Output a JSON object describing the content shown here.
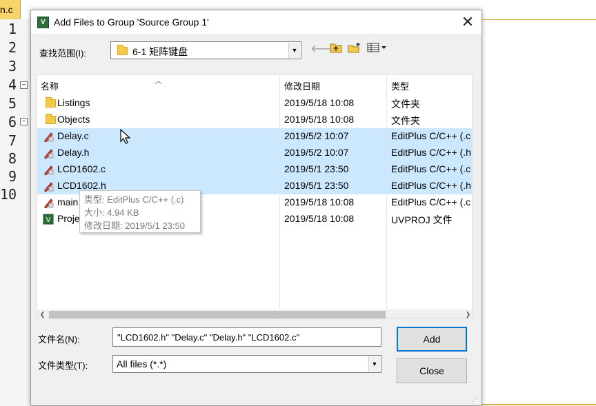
{
  "editor": {
    "tab_label": "n.c",
    "line_numbers": [
      "1",
      "2",
      "3",
      "4",
      "5",
      "6",
      "7",
      "8",
      "9",
      "10"
    ]
  },
  "dialog": {
    "title": "Add Files to Group 'Source Group 1'",
    "close_glyph": "✕",
    "look_in": {
      "label": "查找范围(I):",
      "value": "6-1 矩阵键盘"
    },
    "columns": {
      "name": "名称",
      "date": "修改日期",
      "type": "类型"
    },
    "files": [
      {
        "name": "Listings",
        "date": "2019/5/18 10:08",
        "type": "文件夹",
        "icon": "folder-icon",
        "selected": false
      },
      {
        "name": "Objects",
        "date": "2019/5/18 10:08",
        "type": "文件夹",
        "icon": "folder-icon",
        "selected": false
      },
      {
        "name": "Delay.c",
        "date": "2019/5/2 10:07",
        "type": "EditPlus C/C++ (.c",
        "icon": "editplus-file-icon",
        "selected": true
      },
      {
        "name": "Delay.h",
        "date": "2019/5/2 10:07",
        "type": "EditPlus C/C++ (.h",
        "icon": "editplus-file-icon",
        "selected": true
      },
      {
        "name": "LCD1602.c",
        "date": "2019/5/1 23:50",
        "type": "EditPlus C/C++ (.c",
        "icon": "editplus-file-icon",
        "selected": true
      },
      {
        "name": "LCD1602.h",
        "date": "2019/5/1 23:50",
        "type": "EditPlus C/C++ (.h",
        "icon": "editplus-file-icon",
        "selected": true
      },
      {
        "name": "main",
        "date": "2019/5/18 10:08",
        "type": "EditPlus C/C++ (.c",
        "icon": "editplus-file-icon",
        "selected": false
      },
      {
        "name": "Proje",
        "date": "2019/5/18 10:08",
        "type": "UVPROJ 文件",
        "icon": "uvproj-file-icon",
        "selected": false
      }
    ],
    "tooltip": {
      "type_line": "类型: EditPlus C/C++ (.c)",
      "size_line": "大小: 4.94 KB",
      "date_line": "修改日期: 2019/5/1 23:50"
    },
    "file_name": {
      "label": "文件名(N):",
      "value": "\"LCD1602.h\" \"Delay.c\" \"Delay.h\" \"LCD1602.c\""
    },
    "file_type": {
      "label": "文件类型(T):",
      "value": "All files (*.*)"
    },
    "buttons": {
      "add": "Add",
      "close": "Close"
    }
  },
  "colors": {
    "selection": "#cce8ff",
    "folder": "#f5c94a",
    "default_button_border": "#0078d7",
    "editor_accent": "#d4a83e"
  }
}
